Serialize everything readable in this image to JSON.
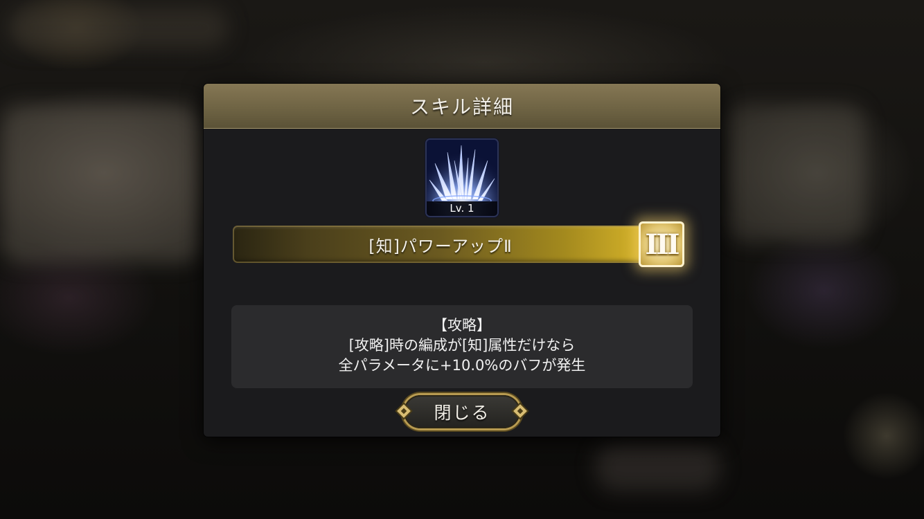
{
  "dialog": {
    "title": "スキル詳細",
    "skill": {
      "icon": "blue-spikes-skill-icon",
      "level": "Lv. 1",
      "name": "[知]パワーアップⅡ",
      "rank": "III"
    },
    "description": {
      "heading": "【攻略】",
      "lines": [
        "[攻略]時の編成が[知]属性だけなら",
        "全パラメータに+10.0%のバフが発生"
      ]
    },
    "close_label": "閉じる"
  },
  "colors": {
    "header_gold": "#7a6d4b",
    "dialog_bg": "#1b1b1d",
    "desc_bg": "#2b2b2d",
    "bar_gold": "#d8b52a",
    "icon_blue": "#0a0f33"
  }
}
